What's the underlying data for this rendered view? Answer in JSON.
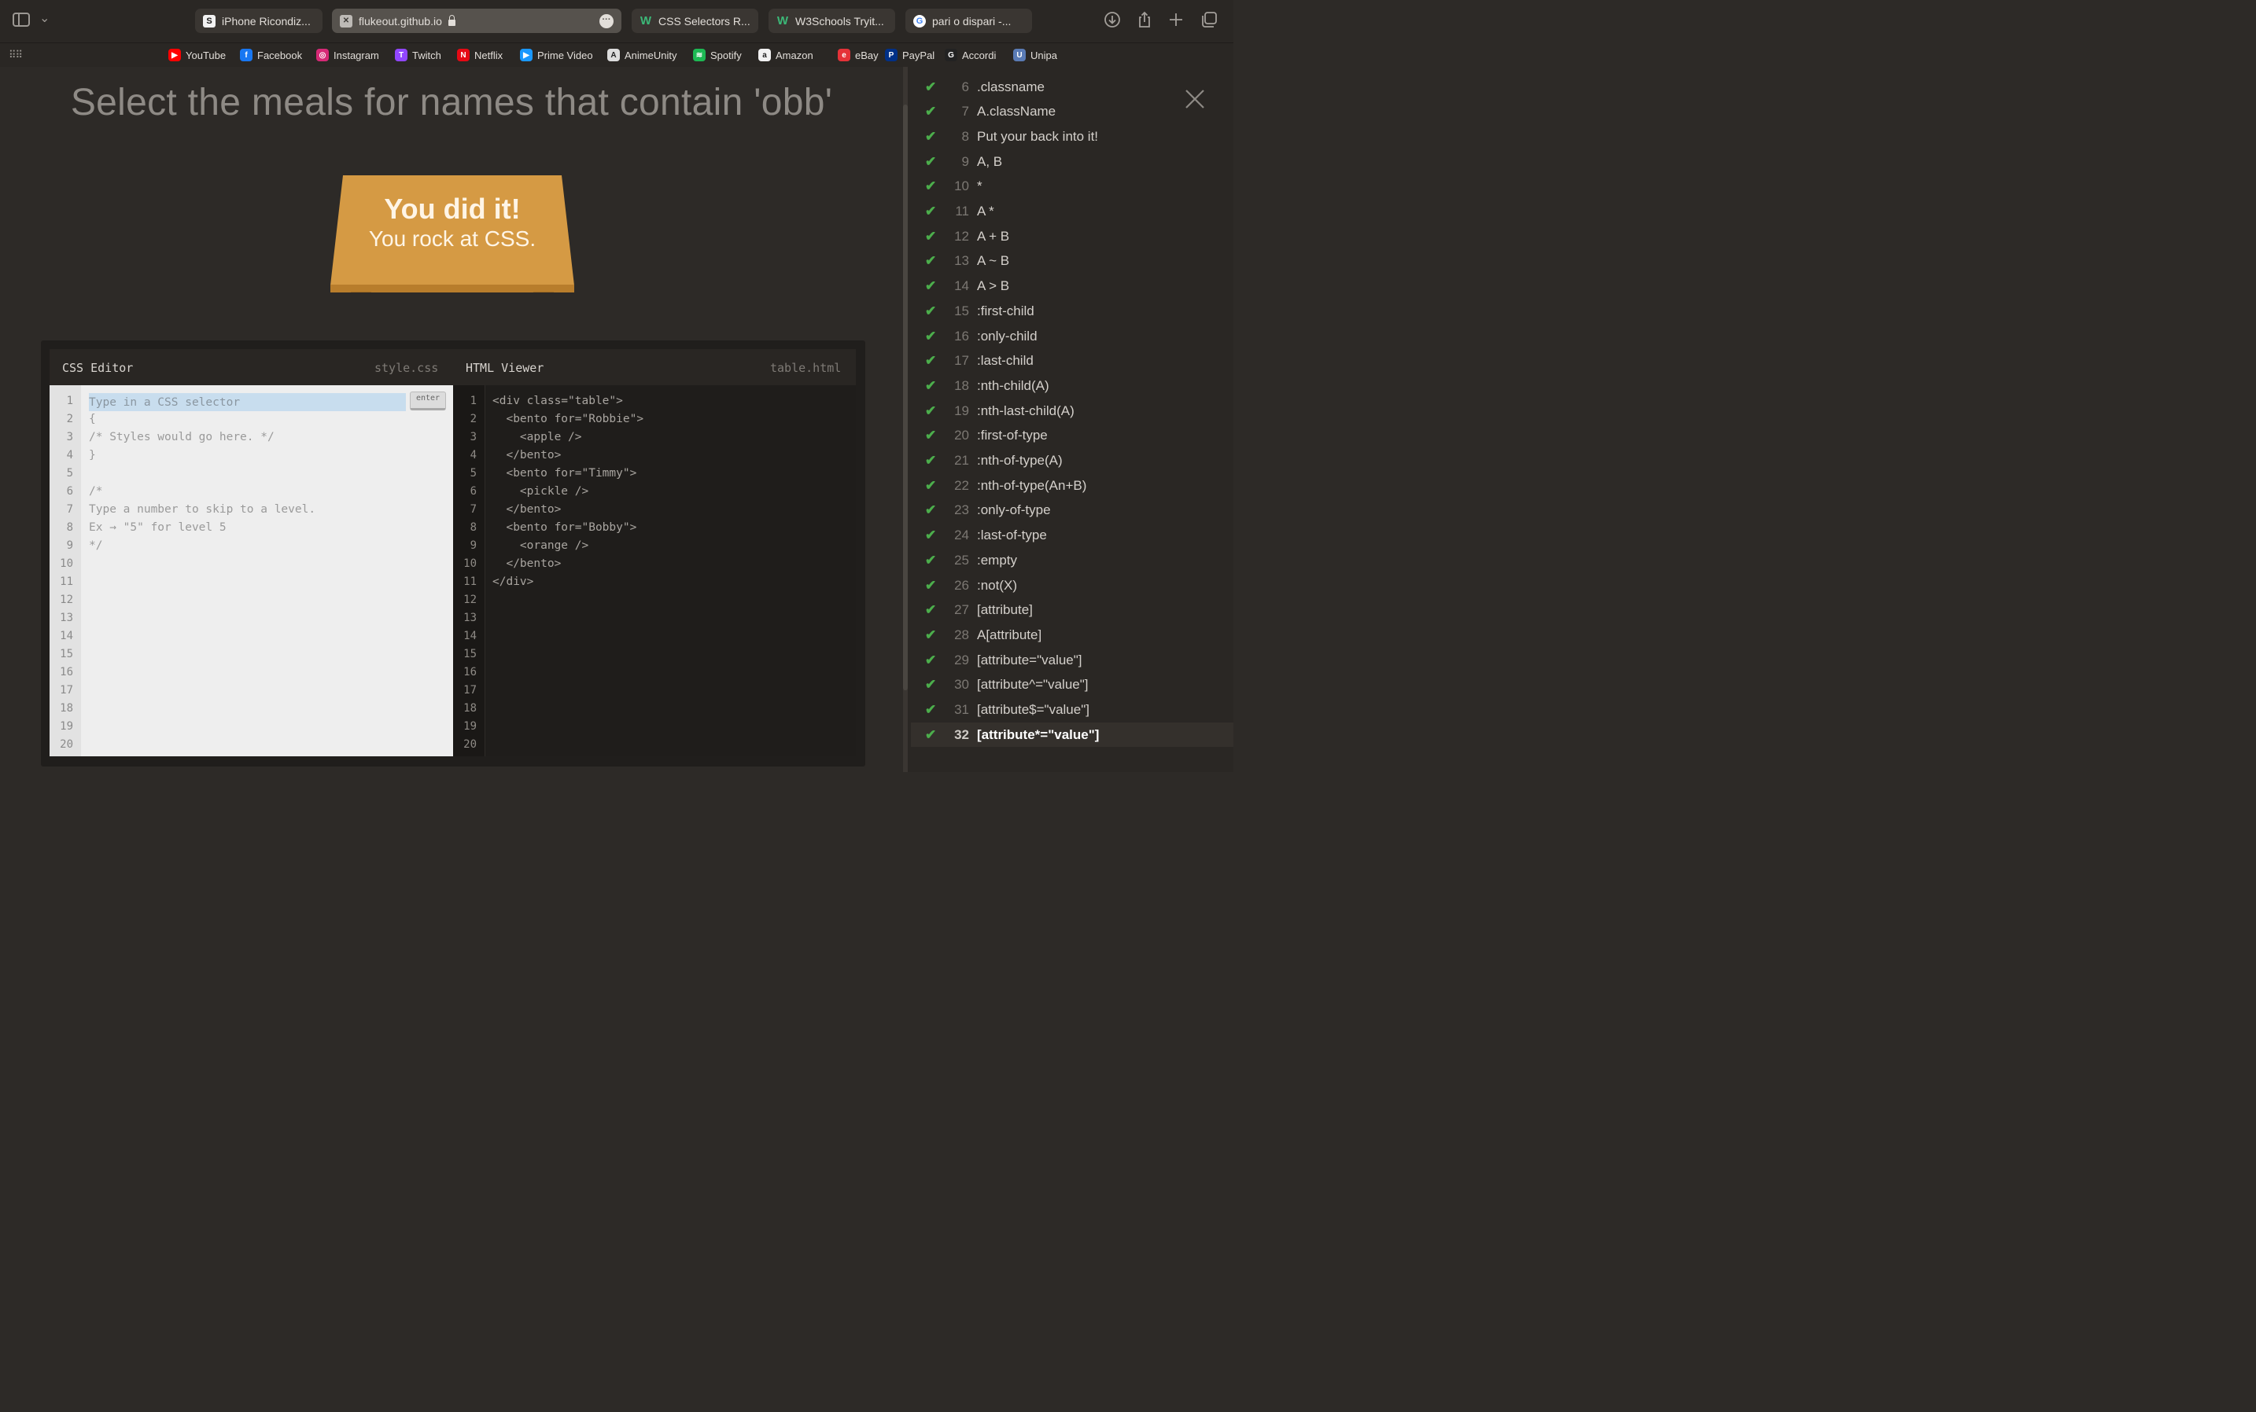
{
  "browser": {
    "tabs": [
      {
        "label": "iPhone Ricondiz...",
        "icon": "s-favicon"
      },
      {
        "label": "flukeout.github.io",
        "icon": "page-favicon",
        "active": true
      },
      {
        "label": "CSS Selectors R...",
        "icon": "w3-favicon"
      },
      {
        "label": "W3Schools Tryit...",
        "icon": "w3-favicon"
      },
      {
        "label": "pari o dispari -...",
        "icon": "google-favicon"
      }
    ],
    "bookmarks": [
      {
        "label": "YouTube",
        "color": "#ff0000",
        "glyph": "▶"
      },
      {
        "label": "Facebook",
        "color": "#1877f2",
        "glyph": "f"
      },
      {
        "label": "Instagram",
        "color": "#d62976",
        "glyph": "◎"
      },
      {
        "label": "Twitch",
        "color": "#9146ff",
        "glyph": "T"
      },
      {
        "label": "Netflix",
        "color": "#e50914",
        "glyph": "N"
      },
      {
        "label": "Prime Video",
        "color": "#1a98ff",
        "glyph": "▶"
      },
      {
        "label": "AnimeUnity",
        "color": "#dddddd",
        "glyph": "A"
      },
      {
        "label": "Spotify",
        "color": "#1db954",
        "glyph": "≋"
      },
      {
        "label": "Amazon",
        "color": "#f2f2f2",
        "glyph": "a"
      },
      {
        "label": "eBay",
        "color": "#e53238",
        "glyph": "e"
      },
      {
        "label": "PayPal",
        "color": "#003087",
        "glyph": "P"
      },
      {
        "label": "Accordi",
        "color": "#222222",
        "glyph": "G"
      },
      {
        "label": "Unipa",
        "color": "#5a7bb5",
        "glyph": "U"
      }
    ]
  },
  "game": {
    "instruction": "Select the meals for names that contain 'obb'",
    "win_title": "You did it!",
    "win_subtitle": "You rock at CSS."
  },
  "editor": {
    "css_title": "CSS Editor",
    "css_file": "style.css",
    "html_title": "HTML Viewer",
    "html_file": "table.html",
    "input_placeholder": "Type in a CSS selector",
    "enter_label": "enter",
    "css_lines": [
      "",
      "{",
      "/* Styles would go here. */",
      "}",
      "",
      "/*",
      "Type a number to skip to a level.",
      "Ex → \"5\" for level 5",
      "*/"
    ],
    "html_lines": [
      "<div class=\"table\">",
      "  <bento for=\"Robbie\">",
      "    <apple />",
      "  </bento>",
      "  <bento for=\"Timmy\">",
      "    <pickle />",
      "  </bento>",
      "  <bento for=\"Bobby\">",
      "    <orange />",
      "  </bento>",
      "</div>"
    ],
    "line_count": 20
  },
  "levels": [
    {
      "num": "6",
      "label": ".classname"
    },
    {
      "num": "7",
      "label": "A.className"
    },
    {
      "num": "8",
      "label": "Put your back into it!"
    },
    {
      "num": "9",
      "label": "A, B"
    },
    {
      "num": "10",
      "label": "*"
    },
    {
      "num": "11",
      "label": "A *"
    },
    {
      "num": "12",
      "label": "A + B"
    },
    {
      "num": "13",
      "label": "A ~ B"
    },
    {
      "num": "14",
      "label": "A > B"
    },
    {
      "num": "15",
      "label": ":first-child"
    },
    {
      "num": "16",
      "label": ":only-child"
    },
    {
      "num": "17",
      "label": ":last-child"
    },
    {
      "num": "18",
      "label": ":nth-child(A)"
    },
    {
      "num": "19",
      "label": ":nth-last-child(A)"
    },
    {
      "num": "20",
      "label": ":first-of-type"
    },
    {
      "num": "21",
      "label": ":nth-of-type(A)"
    },
    {
      "num": "22",
      "label": ":nth-of-type(An+B)"
    },
    {
      "num": "23",
      "label": ":only-of-type"
    },
    {
      "num": "24",
      "label": ":last-of-type"
    },
    {
      "num": "25",
      "label": ":empty"
    },
    {
      "num": "26",
      "label": ":not(X)"
    },
    {
      "num": "27",
      "label": "[attribute]"
    },
    {
      "num": "28",
      "label": "A[attribute]"
    },
    {
      "num": "29",
      "label": "[attribute=\"value\"]"
    },
    {
      "num": "30",
      "label": "[attribute^=\"value\"]"
    },
    {
      "num": "31",
      "label": "[attribute$=\"value\"]"
    },
    {
      "num": "32",
      "label": "[attribute*=\"value\"]",
      "current": true
    }
  ]
}
